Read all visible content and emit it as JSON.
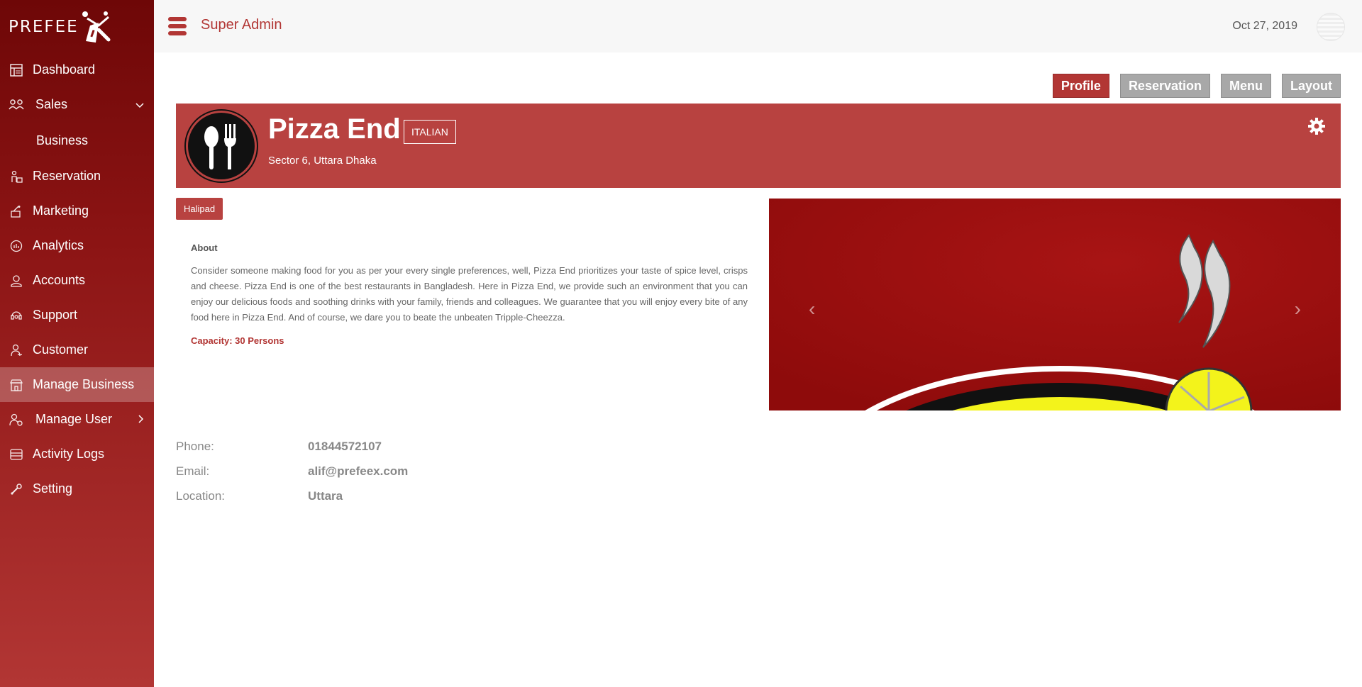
{
  "sidebar": {
    "logo_text": "PREFEE",
    "items": [
      {
        "label": "Dashboard",
        "icon": "dashboard-icon"
      },
      {
        "label": "Sales",
        "icon": "sales-icon",
        "caret": "chevron-down-icon"
      },
      {
        "label": "Business"
      },
      {
        "label": "Reservation",
        "icon": "reservation-icon"
      },
      {
        "label": "Marketing",
        "icon": "marketing-icon"
      },
      {
        "label": "Analytics",
        "icon": "analytics-icon"
      },
      {
        "label": "Accounts",
        "icon": "accounts-icon"
      },
      {
        "label": "Support",
        "icon": "support-icon"
      },
      {
        "label": "Customer",
        "icon": "customer-icon"
      },
      {
        "label": "Manage Business",
        "icon": "manage-business-icon",
        "active": true
      },
      {
        "label": "Manage User",
        "icon": "manage-user-icon",
        "caret": "chevron-right-icon"
      },
      {
        "label": "Activity Logs",
        "icon": "activity-logs-icon"
      },
      {
        "label": "Setting",
        "icon": "setting-icon"
      }
    ]
  },
  "header": {
    "role": "Super Admin",
    "date": "Oct 27, 2019"
  },
  "tabs": [
    {
      "label": "Profile",
      "active": true
    },
    {
      "label": "Reservation"
    },
    {
      "label": "Menu"
    },
    {
      "label": "Layout"
    }
  ],
  "restaurant": {
    "name": "Pizza End",
    "cuisine": "ITALIAN",
    "address": "Sector 6, Uttara Dhaka",
    "area": "Halipad",
    "about_heading": "About",
    "about_text": "Consider someone making food for you as per your every single preferences, well, Pizza End prioritizes your taste of spice level, crisps and cheese. Pizza End is one of the best restaurants in Bangladesh. Here in Pizza End, we provide such an environment that you can enjoy our delicious foods and soothing drinks with your family, friends and colleagues. We guarantee that you will enjoy every bite of any food here in Pizza End. And of course, we dare you to beate the unbeaten Tripple-Cheezza.",
    "capacity": "Capacity: 30 Persons"
  },
  "carousel": {
    "prev": "‹",
    "next": "›"
  },
  "contact": [
    {
      "label": "Phone:",
      "value": "01844572107"
    },
    {
      "label": "Email:",
      "value": "alif@prefeex.com"
    },
    {
      "label": "Location:",
      "value": "Uttara"
    }
  ],
  "colors": {
    "accent": "#b23634",
    "sidebar_top": "#6e0707",
    "banner": "#b84240",
    "tab_inactive": "#a8a8a8"
  }
}
